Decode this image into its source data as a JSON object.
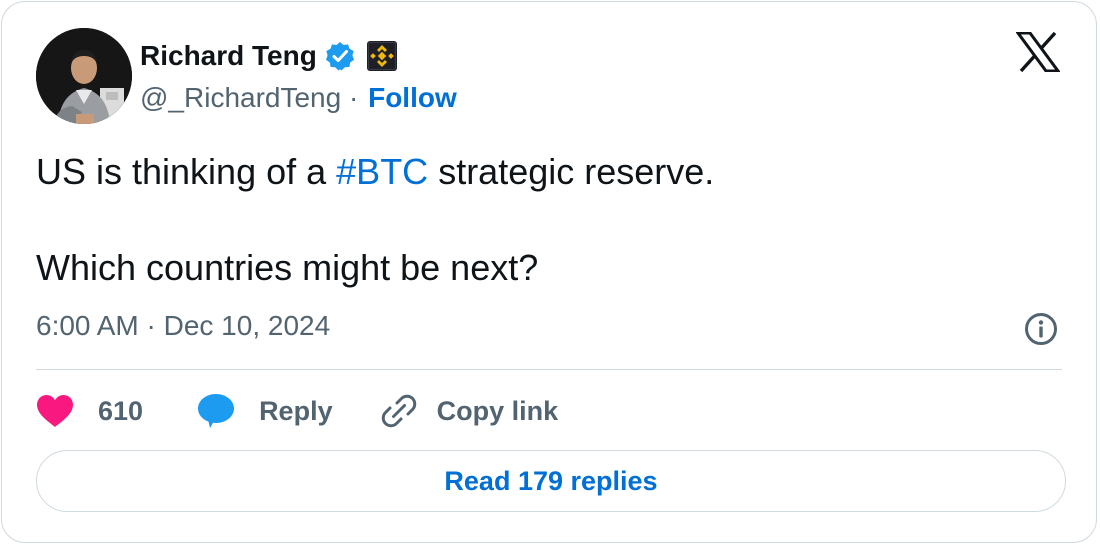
{
  "author": {
    "display_name": "Richard Teng",
    "handle": "@_RichardTeng",
    "separator": "·",
    "follow_label": "Follow"
  },
  "tweet": {
    "line1_before": "US is thinking of a ",
    "hashtag": "#BTC",
    "line1_after": " strategic reserve.",
    "line2": "Which countries might be next?",
    "timestamp": "6:00 AM · Dec 10, 2024"
  },
  "actions": {
    "like_count": "610",
    "reply_label": "Reply",
    "copy_link_label": "Copy link"
  },
  "read_replies_label": "Read 179 replies",
  "icons": {
    "verified": "verified-badge-icon",
    "affiliation": "binance-logo-icon",
    "brand": "x-logo-icon",
    "info": "info-icon",
    "like": "heart-icon",
    "reply": "speech-bubble-icon",
    "copy": "link-icon"
  },
  "colors": {
    "link_blue": "#006fd6",
    "like_pink": "#f91880",
    "reply_blue": "#1d9bf0",
    "muted_text": "#536471",
    "border": "#cfd9de",
    "verified_blue": "#1d9bf0",
    "binance_yellow": "#f0b90b"
  }
}
